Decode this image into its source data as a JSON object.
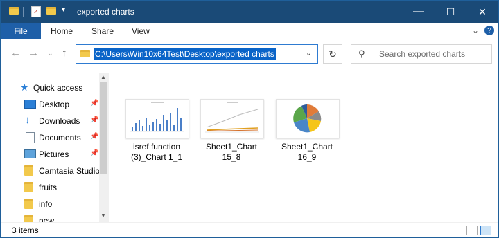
{
  "window": {
    "title": "exported charts",
    "controls": {
      "minimize": "—",
      "maximize": "☐",
      "close": "✕"
    }
  },
  "ribbon": {
    "file": "File",
    "tabs": [
      "Home",
      "Share",
      "View"
    ],
    "expand_icon": "chevron-down-icon",
    "help_icon": "help-icon"
  },
  "address": {
    "path": "C:\\Users\\Win10x64Test\\Desktop\\exported charts",
    "dropdown": "⌄",
    "refresh": "↻"
  },
  "search": {
    "placeholder": "Search exported charts"
  },
  "nav": {
    "items": [
      {
        "label": "Quick access",
        "icon": "star-icon",
        "pinned": false
      },
      {
        "label": "Desktop",
        "icon": "desktop-icon",
        "pinned": true
      },
      {
        "label": "Downloads",
        "icon": "download-icon",
        "pinned": true
      },
      {
        "label": "Documents",
        "icon": "documents-icon",
        "pinned": true
      },
      {
        "label": "Pictures",
        "icon": "pictures-icon",
        "pinned": true
      },
      {
        "label": "Camtasia Studio",
        "icon": "folder-icon",
        "pinned": false
      },
      {
        "label": "fruits",
        "icon": "folder-icon",
        "pinned": false
      },
      {
        "label": "info",
        "icon": "folder-icon",
        "pinned": false
      },
      {
        "label": "new",
        "icon": "folder-icon",
        "pinned": false
      }
    ]
  },
  "files": [
    {
      "line1": "isref function",
      "line2": "(3)_Chart 1_1",
      "kind": "bar"
    },
    {
      "line1": "Sheet1_Chart",
      "line2": "15_8",
      "kind": "line"
    },
    {
      "line1": "Sheet1_Chart",
      "line2": "16_9",
      "kind": "pie"
    }
  ],
  "status": {
    "count": "3 items"
  },
  "colors": {
    "titlebar": "#1a4a77",
    "file_tab": "#1e5fa8",
    "selection": "#0a64c8",
    "folder": "#f2c94c"
  }
}
